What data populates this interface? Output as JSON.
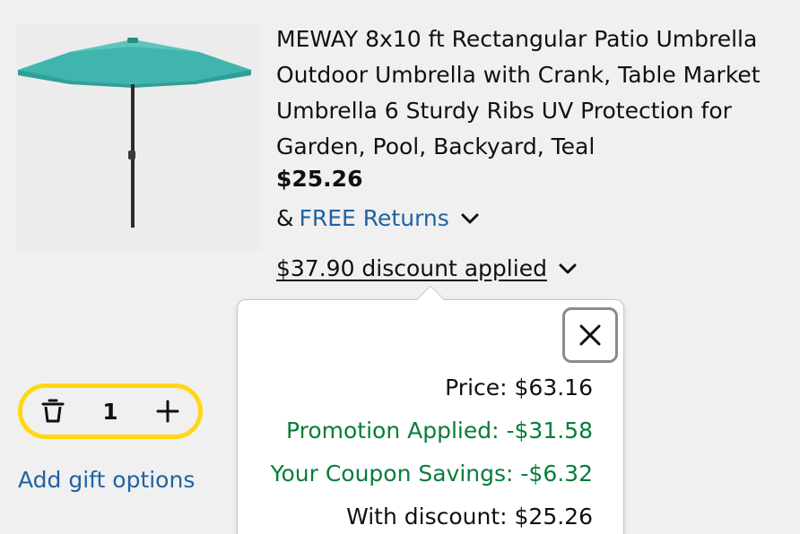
{
  "product": {
    "title": "MEWAY 8x10 ft Rectangular Patio Umbrella Outdoor Umbrella with Crank, Table Market Umbrella 6 Sturdy Ribs UV Protection for Garden, Pool, Backyard, Teal",
    "price": "$25.26",
    "returns_prefix": "&",
    "returns_link": "FREE Returns",
    "discount_text": "$37.90 discount applied",
    "image_icon": "teal-patio-umbrella-image"
  },
  "quantity": {
    "value": "1",
    "delete_icon": "trash-icon",
    "increment_icon": "plus-icon"
  },
  "gift": {
    "label": "Add gift options"
  },
  "popover": {
    "close_icon": "close-icon",
    "price_line": "Price: $63.16",
    "promotion_line": "Promotion Applied: -$31.58",
    "coupon_line": "Your Coupon Savings: -$6.32",
    "final_line": "With discount: $25.26"
  },
  "colors": {
    "link": "#2162a1",
    "savings_green": "#067d3a",
    "qty_border": "#ffd814",
    "umbrella_teal": "#3fb5ad"
  }
}
